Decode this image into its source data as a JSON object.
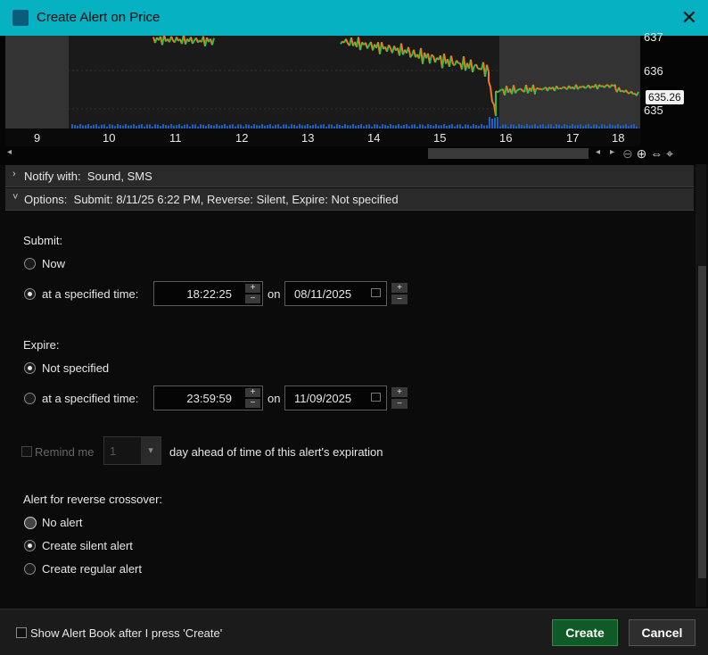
{
  "window": {
    "title": "Create Alert on Price",
    "close_glyph": "✕"
  },
  "chart": {
    "x_labels": [
      "9",
      "10",
      "11",
      "12",
      "13",
      "14",
      "15",
      "16",
      "17",
      "18"
    ],
    "y_labels": [
      "637",
      "636",
      "635"
    ],
    "current_price": "635.26",
    "colors": {
      "up": "#27c24c",
      "down": "#f07a1a",
      "volume": "#1f5fbf"
    }
  },
  "notify": {
    "label": "Notify with:",
    "value": "Sound, SMS"
  },
  "options": {
    "label": "Options:",
    "value": "Submit: 8/11/25 6:22 PM, Reverse: Silent, Expire: Not specified"
  },
  "submit": {
    "heading": "Submit:",
    "now_label": "Now",
    "specified_label": "at a specified time:",
    "time": "18:22:25",
    "on_label": "on",
    "date": "08/11/2025"
  },
  "expire": {
    "heading": "Expire:",
    "not_specified_label": "Not specified",
    "specified_label": "at a specified time:",
    "time": "23:59:59",
    "on_label": "on",
    "date": "11/09/2025"
  },
  "remind": {
    "label": "Remind me",
    "value": "1",
    "suffix": "day ahead of time of this alert's expiration"
  },
  "reverse": {
    "heading": "Alert for reverse crossover:",
    "options": [
      "No alert",
      "Create silent alert",
      "Create regular alert"
    ]
  },
  "footer": {
    "show_book_label": "Show Alert Book after I press 'Create'",
    "create_label": "Create",
    "cancel_label": "Cancel"
  },
  "icons": {
    "plus": "+",
    "minus": "−",
    "chevron_right": "›",
    "chevron_down": "˅",
    "dropdown": "▾"
  },
  "accent_color": "#06b1c1",
  "primary_button_color": "#0f5a26"
}
